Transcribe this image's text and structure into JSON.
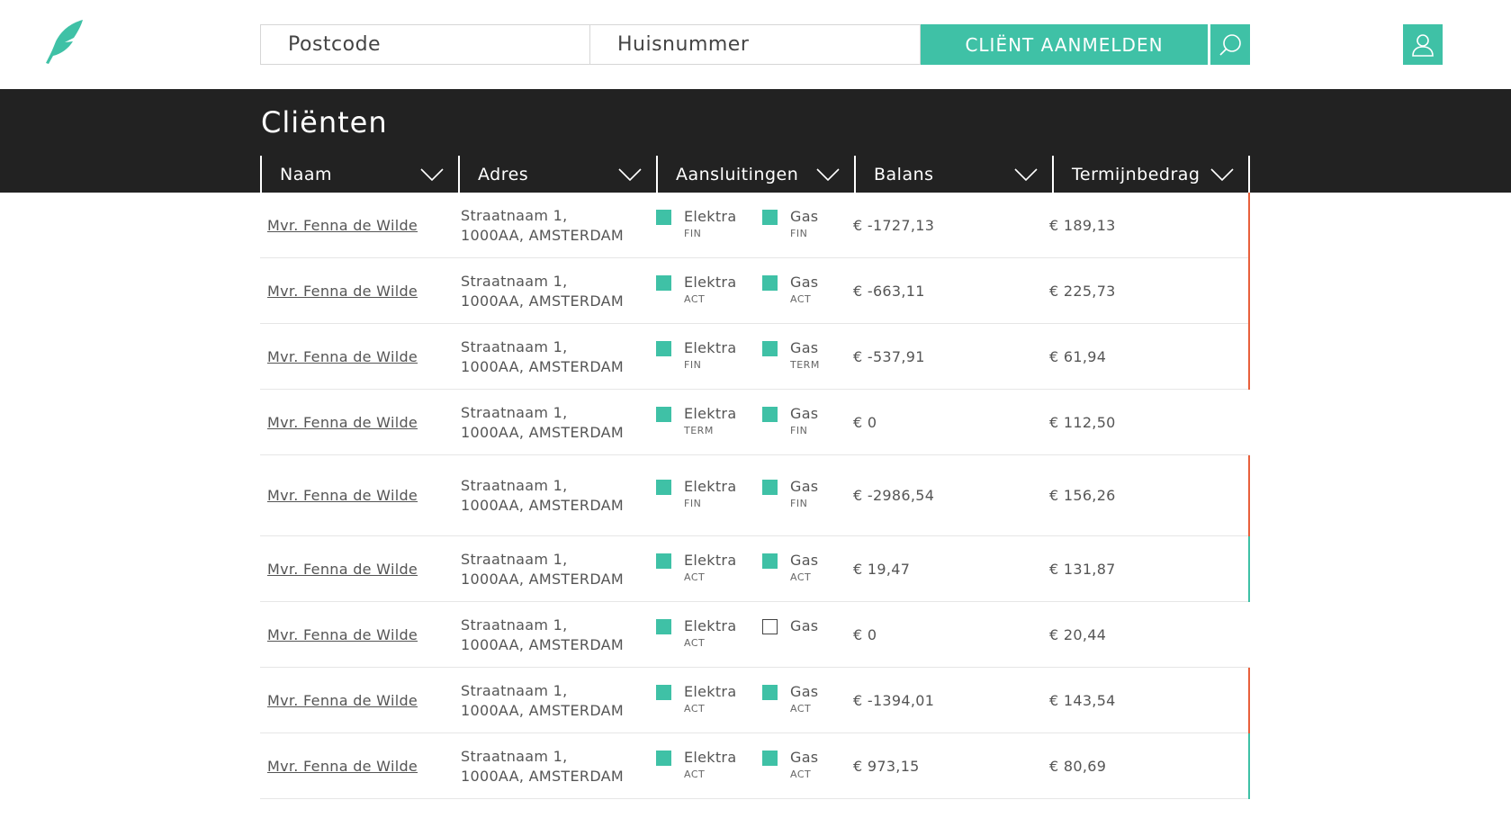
{
  "search": {
    "postcode_placeholder": "Postcode",
    "huisnummer_placeholder": "Huisnummer",
    "submit_label": "CLIËNT AANMELDEN"
  },
  "page": {
    "title": "Cliënten"
  },
  "columns": [
    {
      "label": "Naam"
    },
    {
      "label": "Adres"
    },
    {
      "label": "Aansluitingen"
    },
    {
      "label": "Balans"
    },
    {
      "label": "Termijnbedrag"
    }
  ],
  "colors": {
    "accent": "#3fc1a6",
    "header_bg": "#222222",
    "status_negative": "#e8603c",
    "status_positive": "#3fc1a6"
  },
  "rows": [
    {
      "name": "Mvr. Fenna de Wilde",
      "addr1": "Straatnaam 1,",
      "addr2": "1000AA, AMSTERDAM",
      "elektra_label": "Elektra",
      "elektra_status": "FIN",
      "gas_label": "Gas",
      "gas_status": "FIN",
      "gas_active": true,
      "balans": "€ -1727,13",
      "termijn": "€ 189,13",
      "status": "negative"
    },
    {
      "name": "Mvr. Fenna de Wilde",
      "addr1": "Straatnaam 1,",
      "addr2": "1000AA, AMSTERDAM",
      "elektra_label": "Elektra",
      "elektra_status": "ACT",
      "gas_label": "Gas",
      "gas_status": "ACT",
      "gas_active": true,
      "balans": "€ -663,11",
      "termijn": "€ 225,73",
      "status": "negative"
    },
    {
      "name": "Mvr. Fenna de Wilde",
      "addr1": "Straatnaam 1,",
      "addr2": "1000AA, AMSTERDAM",
      "elektra_label": "Elektra",
      "elektra_status": "FIN",
      "gas_label": "Gas",
      "gas_status": "TERM",
      "gas_active": true,
      "balans": "€ -537,91",
      "termijn": "€ 61,94",
      "status": "negative"
    },
    {
      "name": "Mvr. Fenna de Wilde",
      "addr1": "Straatnaam 1,",
      "addr2": "1000AA, AMSTERDAM",
      "elektra_label": "Elektra",
      "elektra_status": "TERM",
      "gas_label": "Gas",
      "gas_status": "FIN",
      "gas_active": true,
      "balans": "€ 0",
      "termijn": "€ 112,50",
      "status": "none"
    },
    {
      "name": "Mvr. Fenna de Wilde",
      "addr1": "Straatnaam 1,",
      "addr2": "1000AA, AMSTERDAM",
      "elektra_label": "Elektra",
      "elektra_status": "FIN",
      "gas_label": "Gas",
      "gas_status": "FIN",
      "gas_active": true,
      "balans": "€ -2986,54",
      "termijn": "€ 156,26",
      "status": "negative"
    },
    {
      "name": "Mvr. Fenna de Wilde",
      "addr1": "Straatnaam 1,",
      "addr2": "1000AA, AMSTERDAM",
      "elektra_label": "Elektra",
      "elektra_status": "ACT",
      "gas_label": "Gas",
      "gas_status": "ACT",
      "gas_active": true,
      "balans": "€ 19,47",
      "termijn": "€ 131,87",
      "status": "positive"
    },
    {
      "name": "Mvr. Fenna de Wilde",
      "addr1": "Straatnaam 1,",
      "addr2": "1000AA, AMSTERDAM",
      "elektra_label": "Elektra",
      "elektra_status": "ACT",
      "gas_label": "Gas",
      "gas_status": "",
      "gas_active": false,
      "balans": "€ 0",
      "termijn": "€ 20,44",
      "status": "none"
    },
    {
      "name": "Mvr. Fenna de Wilde",
      "addr1": "Straatnaam 1,",
      "addr2": "1000AA, AMSTERDAM",
      "elektra_label": "Elektra",
      "elektra_status": "ACT",
      "gas_label": "Gas",
      "gas_status": "ACT",
      "gas_active": true,
      "balans": "€ -1394,01",
      "termijn": "€ 143,54",
      "status": "negative"
    },
    {
      "name": "Mvr. Fenna de Wilde",
      "addr1": "Straatnaam 1,",
      "addr2": "1000AA, AMSTERDAM",
      "elektra_label": "Elektra",
      "elektra_status": "ACT",
      "gas_label": "Gas",
      "gas_status": "ACT",
      "gas_active": true,
      "balans": "€ 973,15",
      "termijn": "€ 80,69",
      "status": "positive"
    }
  ]
}
